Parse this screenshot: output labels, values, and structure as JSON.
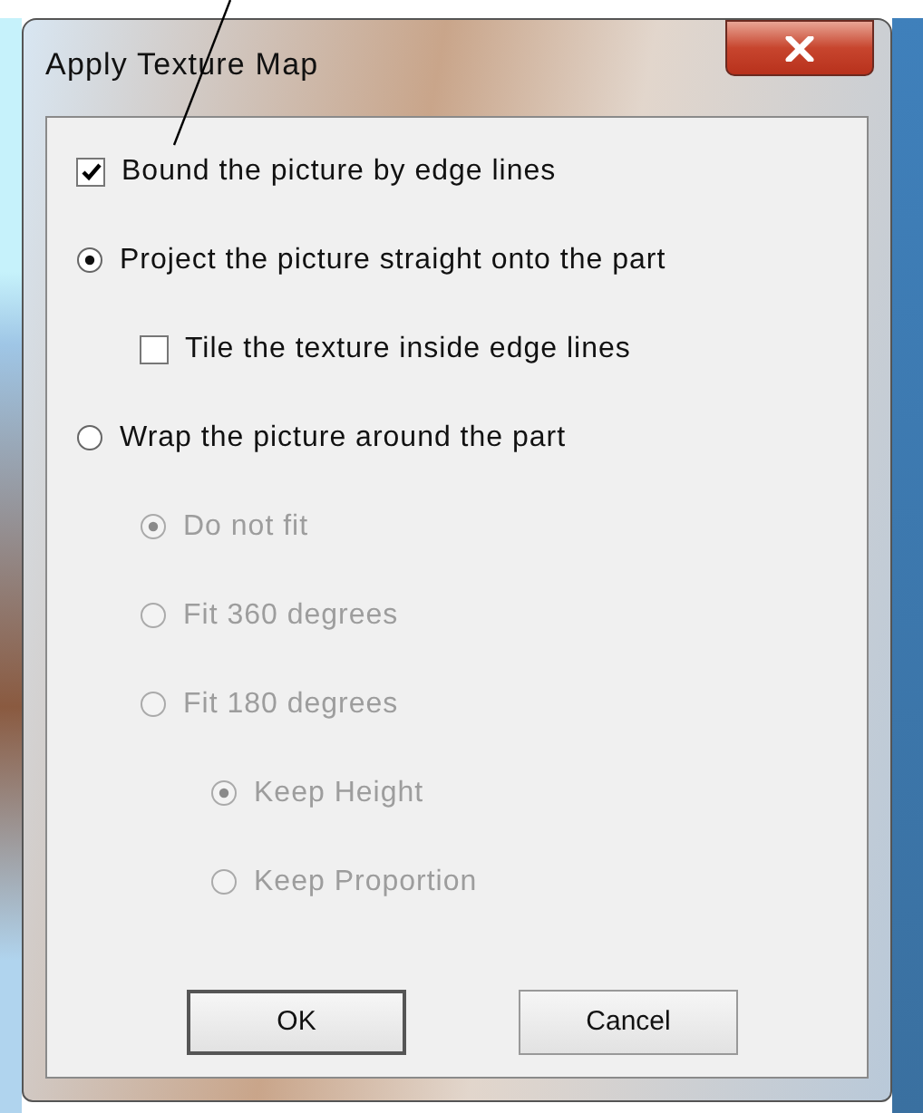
{
  "window": {
    "title": "Apply Texture Map"
  },
  "options": [
    {
      "kind": "checkbox",
      "label": "Bound the picture by edge lines",
      "checked": true,
      "disabled": false
    },
    {
      "kind": "radio",
      "label": "Project the picture straight onto the part",
      "selected": true,
      "disabled": false,
      "children": [
        {
          "kind": "checkbox",
          "label": "Tile the texture inside edge lines",
          "checked": false,
          "disabled": false
        }
      ]
    },
    {
      "kind": "radio",
      "label": "Wrap the picture around the part",
      "selected": false,
      "disabled": false,
      "children": [
        {
          "kind": "radio",
          "label": "Do not fit",
          "selected": true,
          "disabled": true
        },
        {
          "kind": "radio",
          "label": "Fit 360 degrees",
          "selected": false,
          "disabled": true
        },
        {
          "kind": "radio",
          "label": "Fit 180 degrees",
          "selected": false,
          "disabled": true,
          "children": [
            {
              "kind": "radio",
              "label": "Keep Height",
              "selected": true,
              "disabled": true
            },
            {
              "kind": "radio",
              "label": "Keep Proportion",
              "selected": false,
              "disabled": true
            }
          ]
        }
      ]
    }
  ],
  "buttons": [
    {
      "label": "OK",
      "default": true
    },
    {
      "label": "Cancel",
      "default": false
    }
  ]
}
